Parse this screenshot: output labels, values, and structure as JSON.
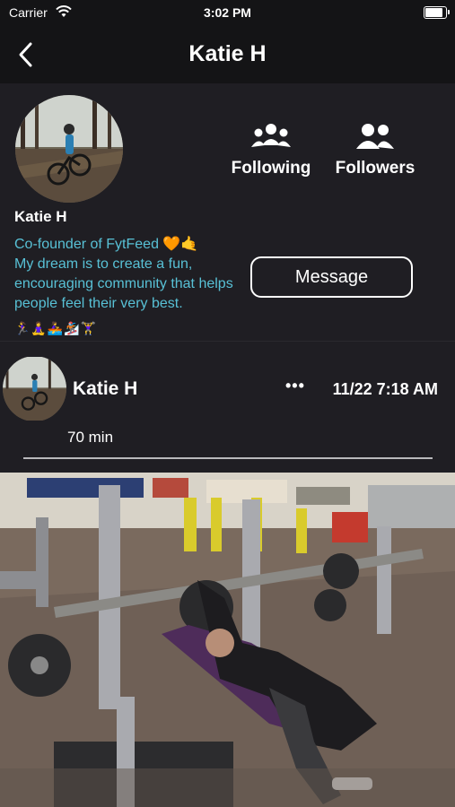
{
  "status_bar": {
    "carrier": "Carrier",
    "time": "3:02 PM",
    "battery_level": 0.95
  },
  "nav": {
    "title": "Katie H"
  },
  "profile": {
    "name": "Katie H",
    "bio_line1": "Co-founder of FytFeed 🧡🤙",
    "bio_line2": "My dream is to create a fun, encouraging community that helps people feel their very best.",
    "emojis": "🏃‍♀️🧘‍♀️🚣‍♀️🏂🏋️‍♀️",
    "following_label": "Following",
    "followers_label": "Followers",
    "message_label": "Message"
  },
  "post": {
    "author": "Katie H",
    "more_label": "•••",
    "timestamp": "11/22 7:18 AM",
    "duration": "70 min"
  },
  "colors": {
    "background": "#1f1e23",
    "header": "#141416",
    "bio_text": "#58c1d6"
  }
}
